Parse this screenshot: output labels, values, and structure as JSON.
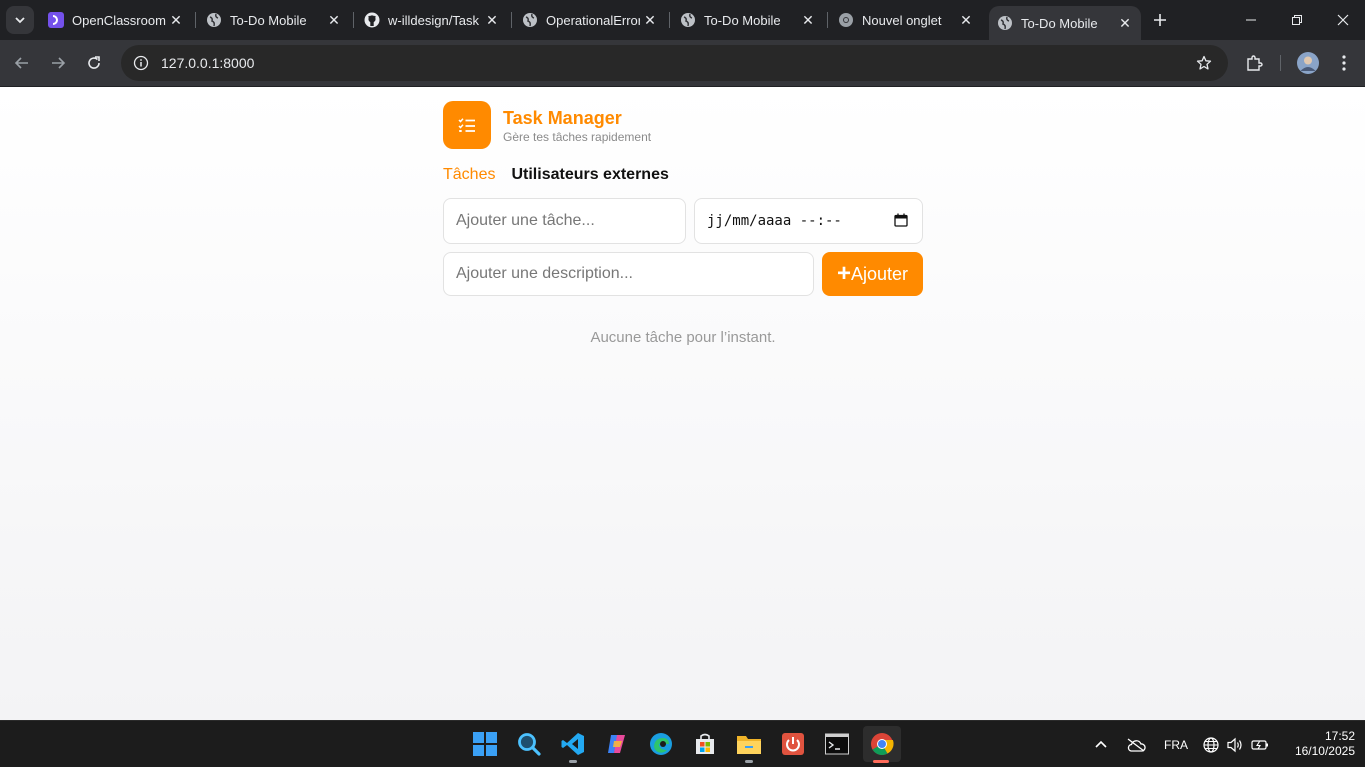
{
  "browser": {
    "tabs": [
      {
        "title": "OpenClassrooms",
        "favicon": "openclassrooms-icon"
      },
      {
        "title": "To-Do Mobile",
        "favicon": "globe-icon"
      },
      {
        "title": "w-illdesign/Task",
        "favicon": "github-icon"
      },
      {
        "title": "OperationalError",
        "favicon": "globe-icon"
      },
      {
        "title": "To-Do Mobile",
        "favicon": "globe-icon"
      },
      {
        "title": "Nouvel onglet",
        "favicon": "chrome-icon"
      },
      {
        "title": "To-Do Mobile",
        "favicon": "globe-icon",
        "active": true
      }
    ],
    "url": "127.0.0.1:8000"
  },
  "app": {
    "title": "Task Manager",
    "subtitle": "Gère tes tâches rapidement",
    "accent_color": "#ff8a00",
    "nav": {
      "tasks": "Tâches",
      "external_users": "Utilisateurs externes"
    },
    "form": {
      "task_placeholder": "Ajouter une tâche...",
      "datetime_placeholder": "jj/mm/aaaa --:--",
      "description_placeholder": "Ajouter une description...",
      "add_button": "Ajouter",
      "add_icon": "+"
    },
    "empty_message": "Aucune tâche pour l’instant."
  },
  "taskbar": {
    "language": "FRA",
    "time": "17:52",
    "date": "16/10/2025"
  }
}
